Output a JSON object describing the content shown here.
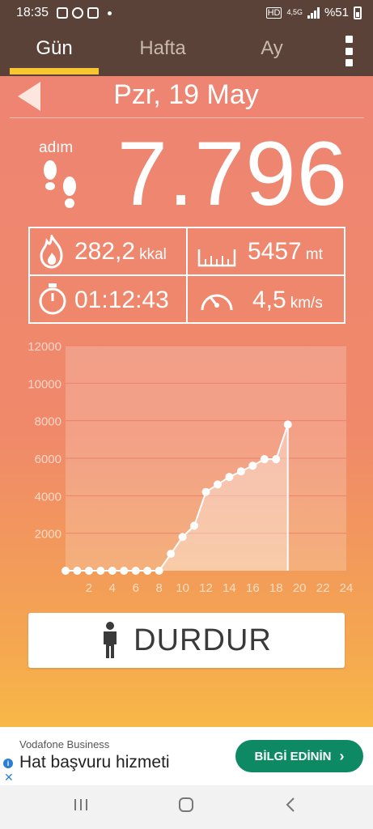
{
  "status_bar": {
    "time": "18:35",
    "network": "4,5G",
    "battery": "%51"
  },
  "tabs": [
    {
      "label": "Gün",
      "active": true
    },
    {
      "label": "Hafta",
      "active": false
    },
    {
      "label": "Ay",
      "active": false
    }
  ],
  "date": "Pzr, 19 May",
  "steps": {
    "label": "adım",
    "value": "7.796"
  },
  "stats": {
    "calories": {
      "value": "282,2",
      "unit": "kkal"
    },
    "distance": {
      "value": "5457",
      "unit": "mt"
    },
    "duration": {
      "value": "01:12:43"
    },
    "speed": {
      "value": "4,5",
      "unit": "km/s"
    }
  },
  "chart_data": {
    "type": "area",
    "x": [
      0,
      1,
      2,
      3,
      4,
      5,
      6,
      7,
      8,
      9,
      10,
      11,
      12,
      13,
      14,
      15,
      16,
      17,
      18,
      19
    ],
    "values": [
      0,
      0,
      0,
      0,
      0,
      0,
      0,
      0,
      0,
      900,
      1800,
      2400,
      4200,
      4600,
      5000,
      5300,
      5600,
      5950,
      5950,
      7796
    ],
    "xticks": [
      "2",
      "4",
      "6",
      "8",
      "10",
      "12",
      "14",
      "16",
      "18",
      "20",
      "22",
      "24"
    ],
    "yticks": [
      "2000",
      "4000",
      "6000",
      "8000",
      "10000",
      "12000"
    ],
    "xlim": [
      0,
      24
    ],
    "ylim": [
      0,
      12000
    ],
    "grid": true
  },
  "button": {
    "label": "DURDUR"
  },
  "ad": {
    "brand": "Vodafone Business",
    "headline": "Hat başvuru hizmeti",
    "cta": "BİLGİ EDİNİN"
  }
}
